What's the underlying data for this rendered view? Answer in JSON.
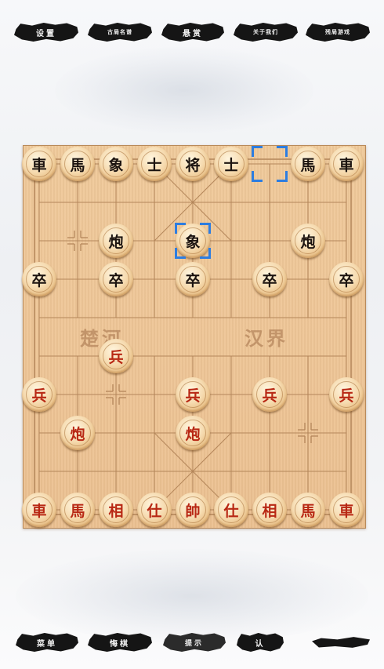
{
  "top_menu": [
    {
      "label": "设置"
    },
    {
      "label": "古局名谱"
    },
    {
      "label": "悬赏"
    },
    {
      "label": "关于我们"
    },
    {
      "label": "残局游戏"
    }
  ],
  "bottom_menu": [
    {
      "label": "菜单"
    },
    {
      "label": "悔棋"
    },
    {
      "label": "提示"
    },
    {
      "label": "认"
    },
    {
      "label": ""
    }
  ],
  "board": {
    "river_left": "楚河",
    "river_right": "汉界",
    "columns": 9,
    "rows": 10
  },
  "colors": {
    "selection": "#2d7de0",
    "red_piece_text": "#b82814",
    "black_piece_text": "#1c1410",
    "board": "#eec596",
    "grid_line": "#b4865a"
  },
  "pieces": [
    {
      "side": "black",
      "char": "車",
      "col": 0,
      "row": 0
    },
    {
      "side": "black",
      "char": "馬",
      "col": 1,
      "row": 0
    },
    {
      "side": "black",
      "char": "象",
      "col": 2,
      "row": 0
    },
    {
      "side": "black",
      "char": "士",
      "col": 3,
      "row": 0
    },
    {
      "side": "black",
      "char": "将",
      "col": 4,
      "row": 0
    },
    {
      "side": "black",
      "char": "士",
      "col": 5,
      "row": 0
    },
    {
      "side": "black",
      "char": "馬",
      "col": 7,
      "row": 0
    },
    {
      "side": "black",
      "char": "車",
      "col": 8,
      "row": 0
    },
    {
      "side": "black",
      "char": "炮",
      "col": 2,
      "row": 2
    },
    {
      "side": "black",
      "char": "象",
      "col": 4,
      "row": 2
    },
    {
      "side": "black",
      "char": "炮",
      "col": 7,
      "row": 2
    },
    {
      "side": "black",
      "char": "卒",
      "col": 0,
      "row": 3
    },
    {
      "side": "black",
      "char": "卒",
      "col": 2,
      "row": 3
    },
    {
      "side": "black",
      "char": "卒",
      "col": 4,
      "row": 3
    },
    {
      "side": "black",
      "char": "卒",
      "col": 6,
      "row": 3
    },
    {
      "side": "black",
      "char": "卒",
      "col": 8,
      "row": 3
    },
    {
      "side": "red",
      "char": "兵",
      "col": 2,
      "row": 5
    },
    {
      "side": "red",
      "char": "兵",
      "col": 0,
      "row": 6
    },
    {
      "side": "red",
      "char": "兵",
      "col": 4,
      "row": 6
    },
    {
      "side": "red",
      "char": "兵",
      "col": 6,
      "row": 6
    },
    {
      "side": "red",
      "char": "兵",
      "col": 8,
      "row": 6
    },
    {
      "side": "red",
      "char": "炮",
      "col": 1,
      "row": 7
    },
    {
      "side": "red",
      "char": "炮",
      "col": 4,
      "row": 7
    },
    {
      "side": "red",
      "char": "車",
      "col": 0,
      "row": 9
    },
    {
      "side": "red",
      "char": "馬",
      "col": 1,
      "row": 9
    },
    {
      "side": "red",
      "char": "相",
      "col": 2,
      "row": 9
    },
    {
      "side": "red",
      "char": "仕",
      "col": 3,
      "row": 9
    },
    {
      "side": "red",
      "char": "帥",
      "col": 4,
      "row": 9
    },
    {
      "side": "red",
      "char": "仕",
      "col": 5,
      "row": 9
    },
    {
      "side": "red",
      "char": "相",
      "col": 6,
      "row": 9
    },
    {
      "side": "red",
      "char": "馬",
      "col": 7,
      "row": 9
    },
    {
      "side": "red",
      "char": "車",
      "col": 8,
      "row": 9
    }
  ],
  "last_move": {
    "from": {
      "col": 6,
      "row": 0
    },
    "to": {
      "col": 4,
      "row": 2
    }
  }
}
